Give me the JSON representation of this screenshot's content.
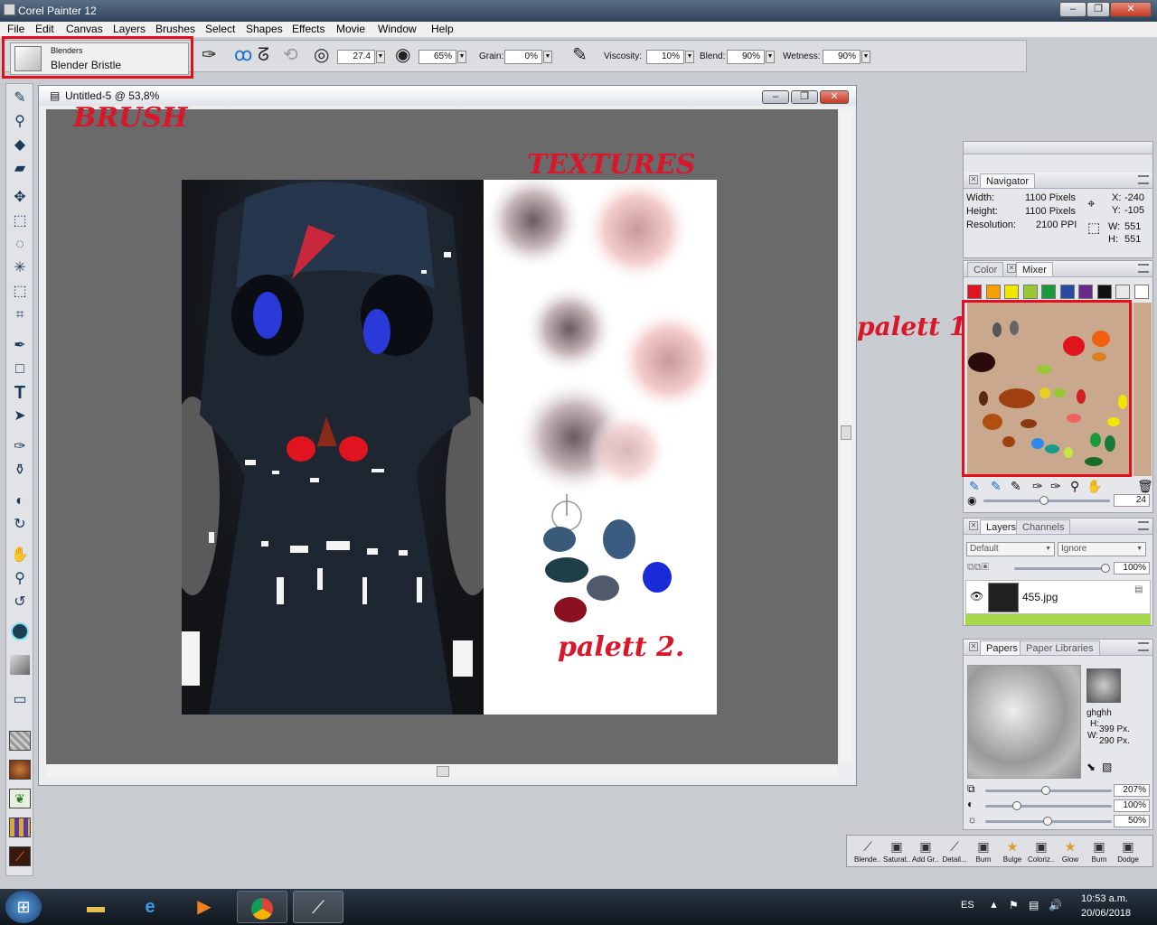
{
  "app": {
    "title": "Corel Painter 12"
  },
  "window_controls": {
    "minimize": "‒",
    "maximize": "❐",
    "close": "✕"
  },
  "menu": [
    "File",
    "Edit",
    "Canvas",
    "Layers",
    "Brushes",
    "Select",
    "Shapes",
    "Effects",
    "Movie",
    "Window",
    "Help"
  ],
  "brush": {
    "category": "Blenders",
    "variant": "Blender Bristle"
  },
  "props": {
    "size": "27.4",
    "opacity": "65%",
    "grain_label": "Grain:",
    "grain": "0%",
    "viscosity_label": "Viscosity:",
    "viscosity": "10%",
    "blend_label": "Blend:",
    "blend": "90%",
    "wetness_label": "Wetness:",
    "wetness": "90%"
  },
  "document": {
    "title": "Untitled-5 @ 53,8%"
  },
  "navigator": {
    "tab": "Navigator",
    "width_label": "Width:",
    "width": "1100 Pixels",
    "height_label": "Height:",
    "height": "1100 Pixels",
    "resolution_label": "Resolution:",
    "resolution": "2100 PPI",
    "x_label": "X:",
    "x": "-240",
    "y_label": "Y:",
    "y": "-105",
    "w_label": "W:",
    "w": "551",
    "h_label": "H:",
    "h": "551"
  },
  "mixer": {
    "tab_color": "Color",
    "tab_mixer": "Mixer",
    "swatches": [
      "#e0141e",
      "#f5a000",
      "#f2e600",
      "#98c832",
      "#1a9a3a",
      "#2a4aa0",
      "#6a2a8a",
      "#111111",
      "#e8e8e8",
      "#ffffff"
    ],
    "brush_size": "24"
  },
  "layers": {
    "tab_layers": "Layers",
    "tab_channels": "Channels",
    "composite_method": "Default",
    "preserve": "Ignore",
    "opacity": "100%",
    "items": [
      {
        "name": "455.jpg"
      }
    ]
  },
  "papers": {
    "tab_papers": "Papers",
    "tab_libraries": "Paper Libraries",
    "name": "ghghh",
    "h_label": "H:",
    "h": "399 Px.",
    "w_label": "W:",
    "w": "290 Px.",
    "scale": "207%",
    "contrast": "100%",
    "brightness": "50%"
  },
  "strip_items": [
    "Blende...",
    "Saturat...",
    "Add Gr...",
    "Detail...",
    "Burn",
    "Bulge",
    "Coloriz...",
    "Glow",
    "Burn",
    "Dodge"
  ],
  "annotations": {
    "brush": "BRUSH",
    "textures": "TEXTURES",
    "palett1": "palett 1",
    "palett2": "palett 2."
  },
  "taskbar": {
    "lang": "ES",
    "time": "10:53 a.m.",
    "date": "20/06/2018"
  }
}
